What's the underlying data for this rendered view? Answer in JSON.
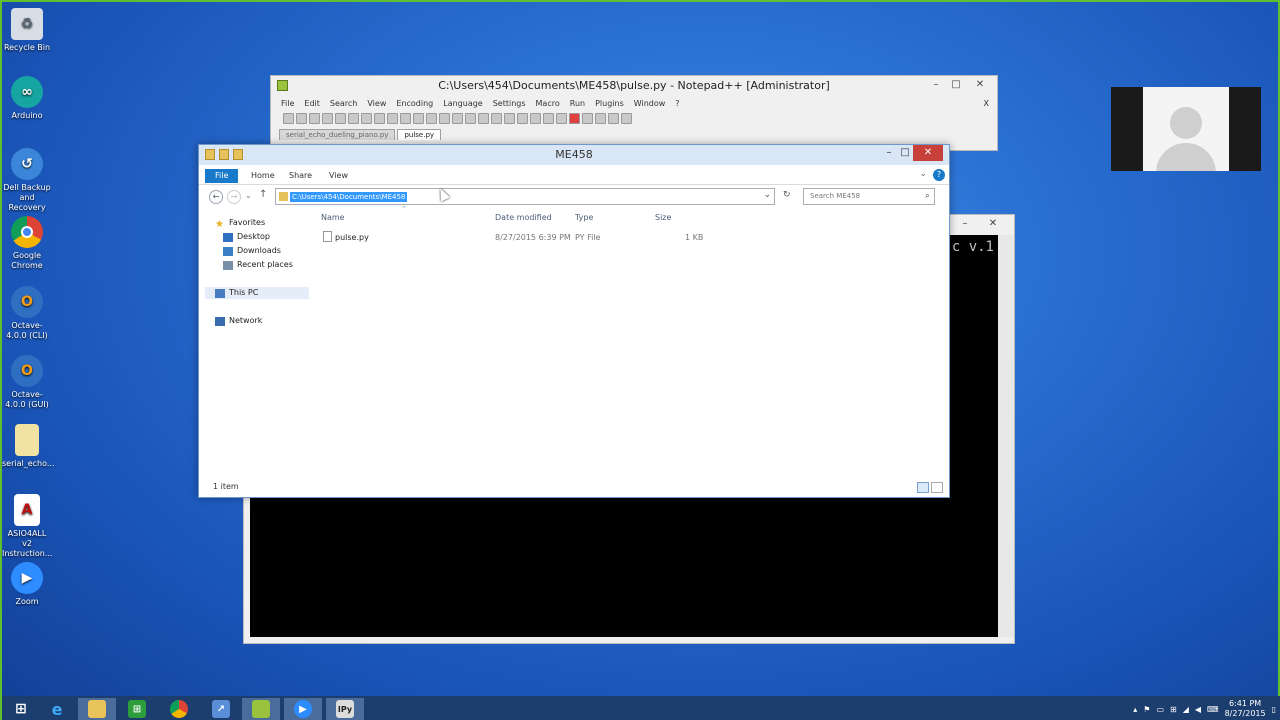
{
  "desktop": {
    "icons": [
      {
        "label": "Recycle Bin",
        "icon": "recycle-bin-icon"
      },
      {
        "label": "Arduino",
        "icon": "arduino-icon"
      },
      {
        "label": "Dell Backup and Recovery",
        "icon": "dell-backup-icon"
      },
      {
        "label": "Google Chrome",
        "icon": "chrome-icon"
      },
      {
        "label": "Octave-4.0.0 (CLI)",
        "icon": "octave-icon"
      },
      {
        "label": "Octave-4.0.0 (GUI)",
        "icon": "octave-icon"
      },
      {
        "label": "serial_echo...",
        "icon": "file-icon"
      },
      {
        "label": "ASIO4ALL v2 Instruction...",
        "icon": "pdf-icon"
      },
      {
        "label": "Zoom",
        "icon": "zoom-icon"
      }
    ]
  },
  "notepad": {
    "title": "C:\\Users\\454\\Documents\\ME458\\pulse.py - Notepad++ [Administrator]",
    "menu": [
      "File",
      "Edit",
      "Search",
      "View",
      "Encoding",
      "Language",
      "Settings",
      "Macro",
      "Run",
      "Plugins",
      "Window",
      "?"
    ],
    "close_doc": "X",
    "tabs": [
      {
        "label": "serial_echo_dueling_piano.py",
        "active": false
      },
      {
        "label": "pulse.py",
        "active": true
      }
    ]
  },
  "console": {
    "visible_text": "c v.1"
  },
  "explorer": {
    "title": "ME458",
    "ribbon_tabs": [
      "File",
      "Home",
      "Share",
      "View"
    ],
    "address": "C:\\Users\\454\\Documents\\ME458",
    "search_placeholder": "Search ME458",
    "nav": {
      "favorites": "Favorites",
      "desktop": "Desktop",
      "downloads": "Downloads",
      "recent": "Recent places",
      "this_pc": "This PC",
      "network": "Network"
    },
    "columns": {
      "name": "Name",
      "date": "Date modified",
      "type": "Type",
      "size": "Size"
    },
    "files": [
      {
        "name": "pulse.py",
        "date": "8/27/2015 6:39 PM",
        "type": "PY File",
        "size": "1 KB"
      }
    ],
    "status": "1 item"
  },
  "taskbar": {
    "time": "6:41 PM",
    "date": "8/27/2015",
    "apps": [
      "start-icon",
      "internet-explorer-icon",
      "file-explorer-icon",
      "store-icon",
      "chrome-icon",
      "remote-icon",
      "notepadpp-icon",
      "zoom-icon",
      "ipython-icon"
    ]
  },
  "colors": {
    "desktop_bg": "#2a6fd2",
    "taskbar_bg": "#1c3e6e",
    "selection": "#3399ff",
    "close_red": "#c7403a"
  }
}
